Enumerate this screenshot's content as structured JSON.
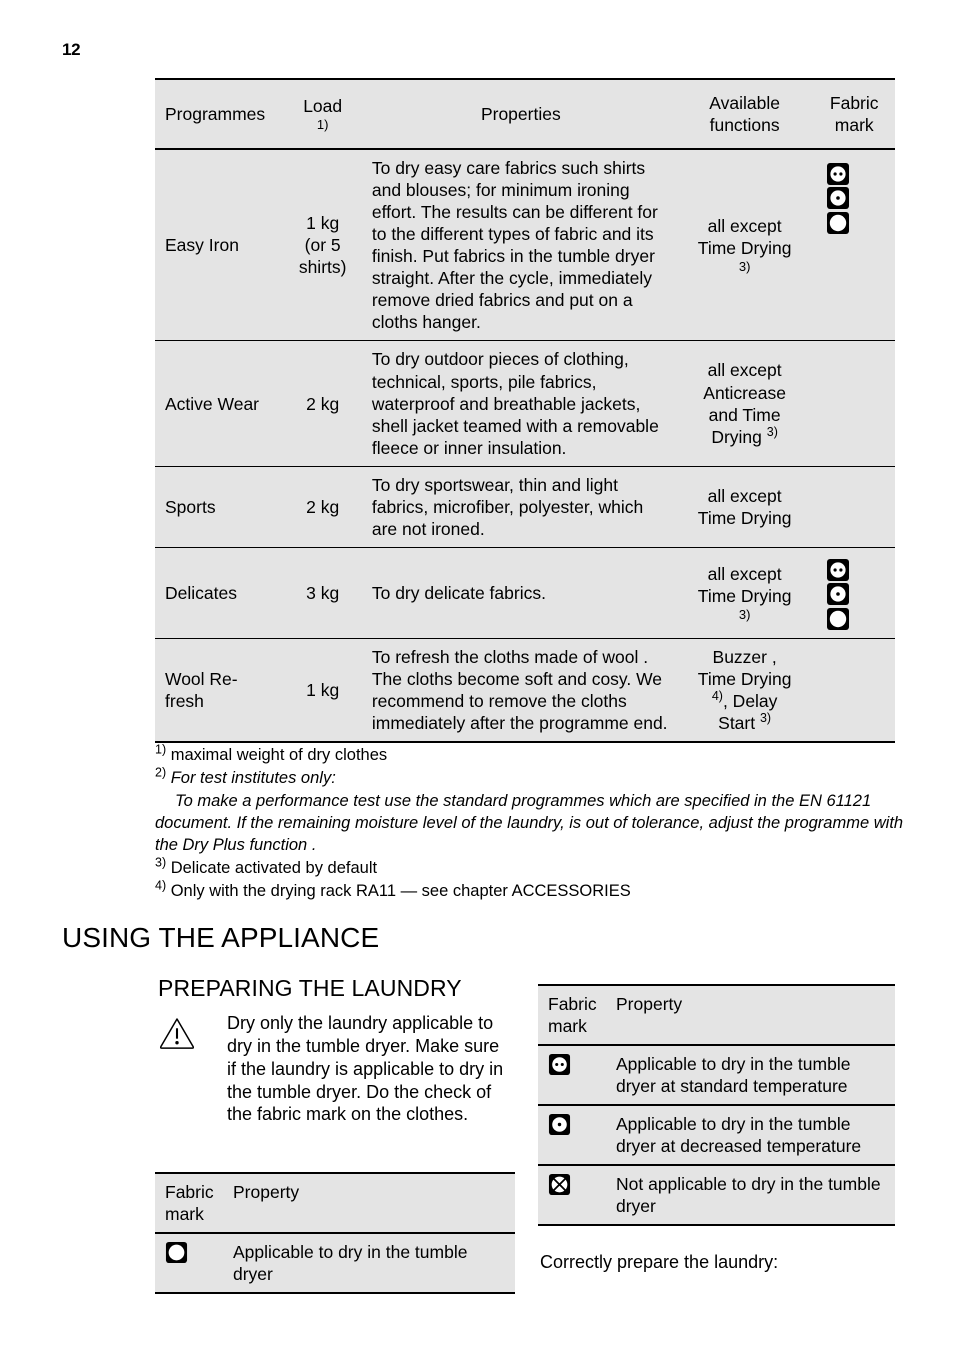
{
  "page": {
    "number": "12"
  },
  "programmes_table": {
    "headers": {
      "programmes": "Programmes",
      "load": "Load",
      "load_fn": "1)",
      "properties": "Properties",
      "available_functions_l1": "Available",
      "available_functions_l2": "functions",
      "fabric_mark_l1": "Fabric",
      "fabric_mark_l2": "mark"
    },
    "rows": [
      {
        "programme": "Easy Iron",
        "load_l1": "1 kg",
        "load_l2": "(or 5",
        "load_l3": "shirts)",
        "properties": "To dry easy care fabrics such shirts and blouses; for minimum ironing effort. The results can be different for to the different types of fabric and its finish. Put fabrics in the tumble dryer straight. After the cycle, immediately remove dried fabrics and put on a cloths hanger.",
        "functions_l1": "all except",
        "functions_l2": "Time Drying",
        "functions_fn": "3)",
        "marks": [
          "standard-temp-icon",
          "decreased-temp-icon",
          "tumble-dry-icon"
        ]
      },
      {
        "programme": "Active Wear",
        "load_l1": "2 kg",
        "load_l2": "",
        "load_l3": "",
        "properties": "To dry outdoor pieces of clothing, technical, sports, pile fabrics, waterproof and breathable jackets, shell jacket teamed with a removable fleece or inner insulation.",
        "functions_l1": "all except",
        "functions_l2": "Anticrease",
        "functions_l3": "and Time",
        "functions_l4": "Drying",
        "functions_fn": "3)",
        "marks": []
      },
      {
        "programme": "Sports",
        "load_l1": "2 kg",
        "load_l2": "",
        "load_l3": "",
        "properties": "To dry sportswear, thin and light fabrics, microfiber, polyester, which are not ironed.",
        "functions_l1": "all except",
        "functions_l2": "Time Drying",
        "functions_fn": "",
        "marks": []
      },
      {
        "programme": "Delicates",
        "load_l1": "3 kg",
        "load_l2": "",
        "load_l3": "",
        "properties": "To dry delicate fabrics.",
        "functions_l1": "all except",
        "functions_l2": "Time Drying",
        "functions_fn": "3)",
        "marks": [
          "standard-temp-icon",
          "decreased-temp-icon",
          "tumble-dry-icon"
        ]
      },
      {
        "programme_l1": "Wool Re-",
        "programme_l2": "fresh",
        "load_l1": "1 kg",
        "load_l2": "",
        "load_l3": "",
        "properties": "To refresh the cloths made of wool . The cloths become soft and cosy. We recommend to remove the cloths immediately after the programme end.",
        "functions_l1": "Buzzer ,",
        "functions_l2": "Time Drying",
        "functions_fn2": "4)",
        "functions_l3": ", Delay",
        "functions_l4": "Start",
        "functions_fn": "3)",
        "marks": []
      }
    ]
  },
  "footnotes": {
    "n1_num": "1)",
    "n1_text": "maximal weight of dry clothes",
    "n2_num": "2)",
    "n2_text": "For test institutes only:",
    "n2_body": "To make a performance test use the standard programmes which are specified in the EN 61121 document. If the remaining moisture level of the laundry, is out of tolerance, adjust the programme with the Dry Plus function .",
    "n3_num": "3)",
    "n3_text": "Delicate activated by default",
    "n4_num": "4)",
    "n4_text": "Only with the drying rack RA11 — see chapter ACCESSORIES"
  },
  "section": {
    "title": "USING THE APPLIANCE",
    "subtitle": "PREPARING THE LAUNDRY",
    "warning_text": "Dry only the laundry applicable to dry in the tumble dryer. Make sure if the laundry is applicable to dry in the tumble dryer. Do the check of the fabric mark on the clothes.",
    "warning_icon": "warning-triangle-icon"
  },
  "fabric_table_left": {
    "header_mark_l1": "Fabric",
    "header_mark_l2": "mark",
    "header_property": "Property",
    "rows": [
      {
        "icon": "tumble-dry-icon",
        "property": "Applicable to dry in the tumble dryer"
      }
    ]
  },
  "fabric_table_right": {
    "header_mark_l1": "Fabric",
    "header_mark_l2": "mark",
    "header_property": "Property",
    "rows": [
      {
        "icon": "standard-temp-icon",
        "property": "Applicable to dry in the tumble dryer at standard temperature"
      },
      {
        "icon": "decreased-temp-icon",
        "property": "Applicable to dry in the tumble dryer at decreased temperature"
      },
      {
        "icon": "not-applicable-icon",
        "property": "Not applicable to dry in the tumble dryer"
      }
    ]
  },
  "closing_line": "Correctly prepare the laundry:",
  "colors": {
    "table_background": "#e4e4e4",
    "rule": "#000000",
    "text": "#000000",
    "page_background": "#ffffff"
  }
}
